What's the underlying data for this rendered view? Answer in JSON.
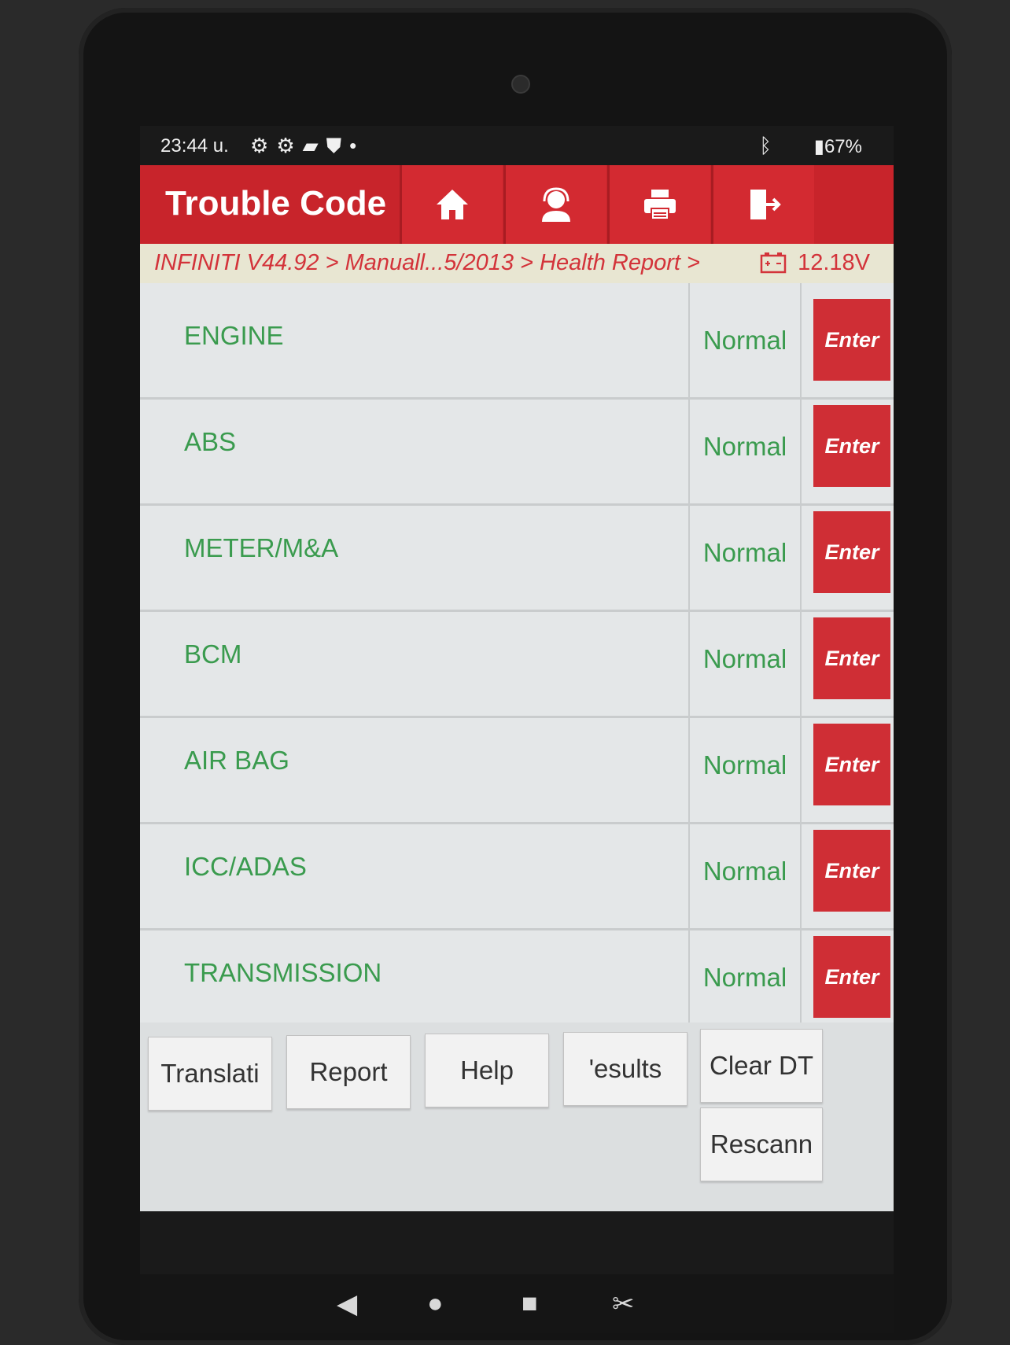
{
  "status_bar": {
    "time": "23:44 u.",
    "battery": "67%"
  },
  "header": {
    "title": "Trouble Code",
    "buttons": [
      {
        "icon": "home-icon"
      },
      {
        "icon": "support-agent-icon"
      },
      {
        "icon": "print-icon"
      },
      {
        "icon": "exit-icon"
      }
    ]
  },
  "breadcrumb": {
    "path": "INFINITI V44.92 > Manuall...5/2013 > Health Report >",
    "voltage": "12.18V"
  },
  "systems": [
    {
      "name": "ENGINE",
      "status": "Normal",
      "action": "Enter"
    },
    {
      "name": "ABS",
      "status": "Normal",
      "action": "Enter"
    },
    {
      "name": "METER/M&A",
      "status": "Normal",
      "action": "Enter"
    },
    {
      "name": "BCM",
      "status": "Normal",
      "action": "Enter"
    },
    {
      "name": "AIR BAG",
      "status": "Normal",
      "action": "Enter"
    },
    {
      "name": "ICC/ADAS",
      "status": "Normal",
      "action": "Enter"
    },
    {
      "name": "TRANSMISSION",
      "status": "Normal",
      "action": "Enter"
    }
  ],
  "toolbar": {
    "translation": "Translati",
    "report": "Report",
    "help": "Help",
    "results": "'esults",
    "clear_dtc": "Clear DT",
    "rescan": "Rescann"
  },
  "colors": {
    "header_red": "#c8242b",
    "status_green": "#3a9b4e",
    "enter_red": "#cf2e35"
  }
}
